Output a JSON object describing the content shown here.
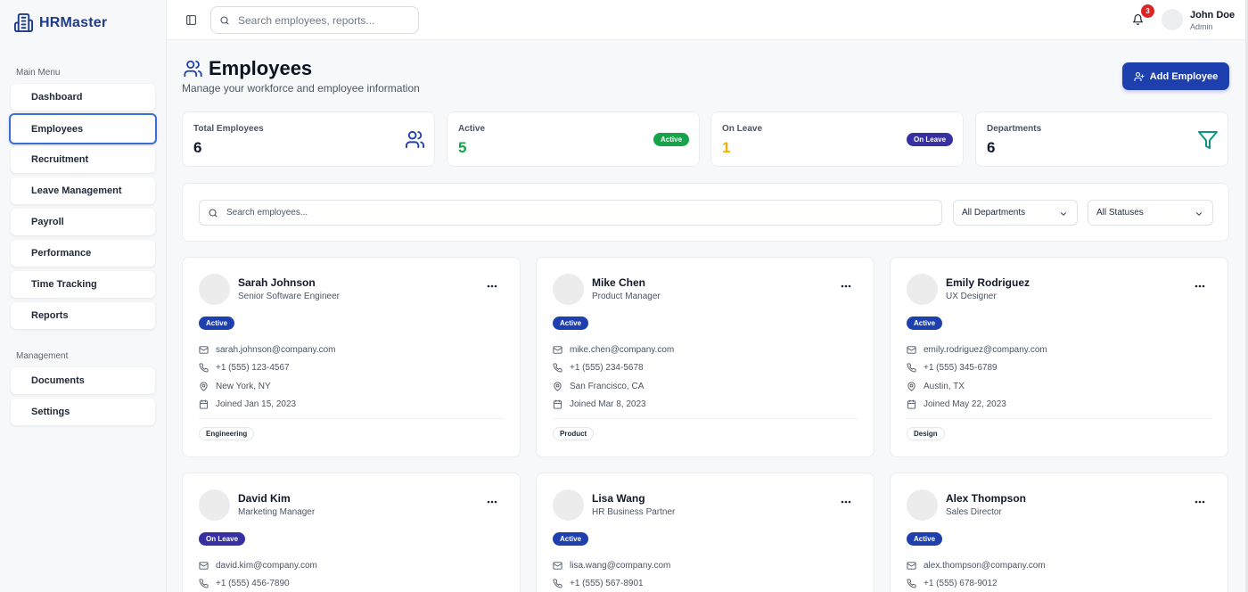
{
  "app": {
    "name": "HRMaster"
  },
  "sidebar": {
    "main_label": "Main Menu",
    "main_items": [
      {
        "label": "Dashboard"
      },
      {
        "label": "Employees",
        "active": true
      },
      {
        "label": "Recruitment"
      },
      {
        "label": "Leave Management"
      },
      {
        "label": "Payroll"
      },
      {
        "label": "Performance"
      },
      {
        "label": "Time Tracking"
      },
      {
        "label": "Reports"
      }
    ],
    "management_label": "Management",
    "management_items": [
      {
        "label": "Documents"
      },
      {
        "label": "Settings"
      }
    ]
  },
  "topbar": {
    "search_placeholder": "Search employees, reports...",
    "notification_count": "3",
    "user_name": "John Doe",
    "user_role": "Admin"
  },
  "header": {
    "title": "Employees",
    "subtitle": "Manage your workforce and employee information",
    "add_button": "Add Employee"
  },
  "stats": [
    {
      "label": "Total Employees",
      "value": "6",
      "icon": "users-icon"
    },
    {
      "label": "Active",
      "value": "5",
      "badge": "Active",
      "color": "#16a34a"
    },
    {
      "label": "On Leave",
      "value": "1",
      "badge": "On Leave",
      "color": "#eab308"
    },
    {
      "label": "Departments",
      "value": "6",
      "icon": "filter-icon"
    }
  ],
  "filters": {
    "search_placeholder": "Search employees...",
    "department": "All Departments",
    "status": "All Statuses"
  },
  "employees": [
    {
      "name": "Sarah Johnson",
      "role": "Senior Software Engineer",
      "status": "Active",
      "email": "sarah.johnson@company.com",
      "phone": "+1 (555) 123-4567",
      "location": "New York, NY",
      "joined": "Joined Jan 15, 2023",
      "department": "Engineering"
    },
    {
      "name": "Mike Chen",
      "role": "Product Manager",
      "status": "Active",
      "email": "mike.chen@company.com",
      "phone": "+1 (555) 234-5678",
      "location": "San Francisco, CA",
      "joined": "Joined Mar 8, 2023",
      "department": "Product"
    },
    {
      "name": "Emily Rodriguez",
      "role": "UX Designer",
      "status": "Active",
      "email": "emily.rodriguez@company.com",
      "phone": "+1 (555) 345-6789",
      "location": "Austin, TX",
      "joined": "Joined May 22, 2023",
      "department": "Design"
    },
    {
      "name": "David Kim",
      "role": "Marketing Manager",
      "status": "On Leave",
      "email": "david.kim@company.com",
      "phone": "+1 (555) 456-7890"
    },
    {
      "name": "Lisa Wang",
      "role": "HR Business Partner",
      "status": "Active",
      "email": "lisa.wang@company.com",
      "phone": "+1 (555) 567-8901"
    },
    {
      "name": "Alex Thompson",
      "role": "Sales Director",
      "status": "Active",
      "email": "alex.thompson@company.com",
      "phone": "+1 (555) 678-9012"
    }
  ],
  "colors": {
    "primary": "#1e40af",
    "active_badge": "#1e40af",
    "on_leave_badge": "#3730a3",
    "active_stat": "#16a34a",
    "leave_stat": "#eab308",
    "notification": "#dc2626"
  }
}
